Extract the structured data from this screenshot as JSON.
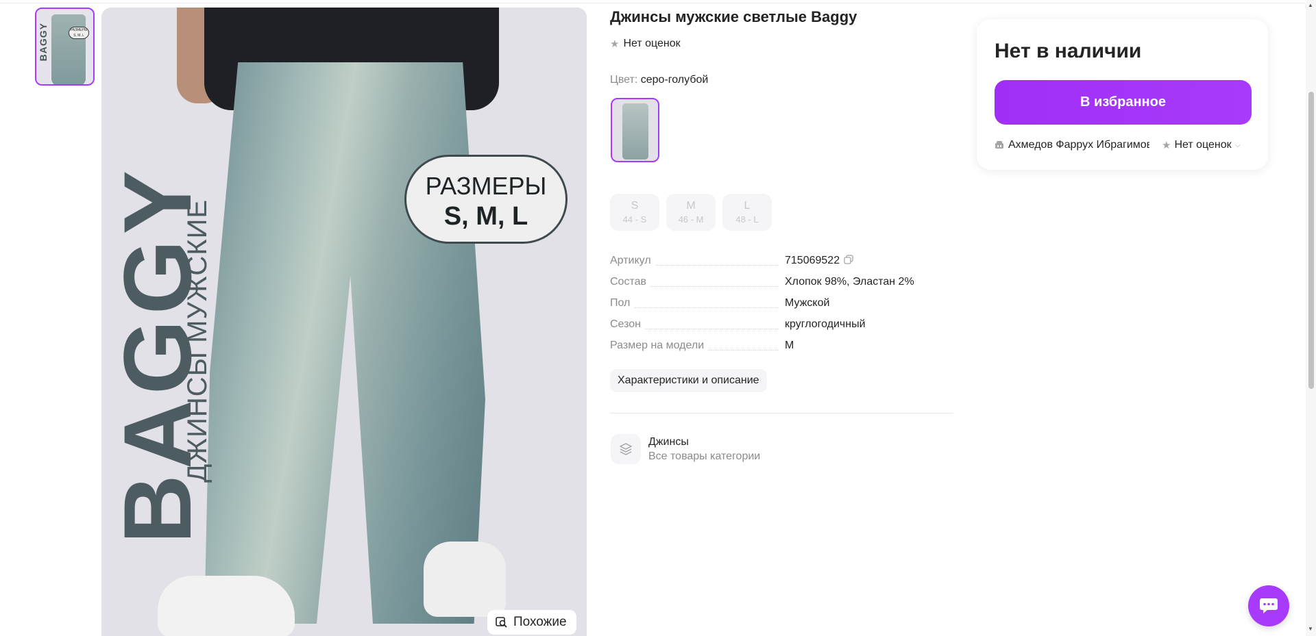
{
  "product": {
    "title": "Джинсы мужские светлые Baggy",
    "rating_text": "Нет оценок",
    "color_label": "Цвет:",
    "color_value": "серо-голубой"
  },
  "gallery": {
    "image_overlay": {
      "brand": "BAGGY",
      "subtitle": "ДЖИНСЫ МУЖСКИЕ",
      "pill_line1": "РАЗМЕРЫ",
      "pill_line2": "S, M, L"
    },
    "thumb_overlay": {
      "brand": "BAGGY",
      "pill": "РАЗМЕРЫ S, M, L"
    },
    "similar_label": "Похожие"
  },
  "sizes": [
    {
      "label": "S",
      "ru": "44 - S"
    },
    {
      "label": "M",
      "ru": "46 - M"
    },
    {
      "label": "L",
      "ru": "48 - L"
    }
  ],
  "specs": [
    {
      "key": "Артикул",
      "value": "715069522"
    },
    {
      "key": "Состав",
      "value": "Хлопок 98%, Эластан 2%"
    },
    {
      "key": "Пол",
      "value": "Мужской"
    },
    {
      "key": "Сезон",
      "value": "круглогодичный"
    },
    {
      "key": "Размер на модели",
      "value": "M"
    }
  ],
  "specs_button": "Характеристики и описание",
  "category": {
    "name": "Джинсы",
    "link": "Все товары категории"
  },
  "card": {
    "stock": "Нет в наличии",
    "favorite_button": "В избранное",
    "seller_name": "Ахмедов Фаррух Ибрагимович",
    "seller_rating": "Нет оценок"
  },
  "colors": {
    "accent": "#a73afd",
    "muted_text": "#8b8b8b",
    "chip_bg": "#f5f5f7"
  }
}
